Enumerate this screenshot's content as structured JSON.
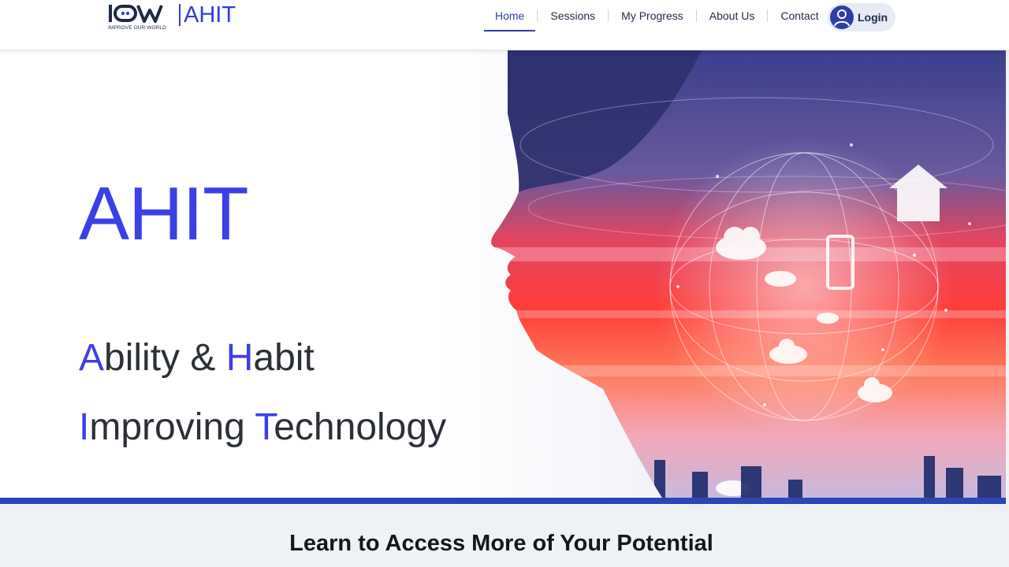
{
  "brand": {
    "mark": "IOW",
    "tagline": "IMPROVE OUR WORLD",
    "product": "AHIT",
    "color_primary": "#2d3ee0",
    "color_dark": "#1f2a44"
  },
  "nav": {
    "items": [
      {
        "label": "Home",
        "active": true
      },
      {
        "label": "Sessions",
        "active": false
      },
      {
        "label": "My Progress",
        "active": false
      },
      {
        "label": "About Us",
        "active": false
      },
      {
        "label": "Contact",
        "active": false
      }
    ],
    "login_label": "Login",
    "login_icon": "user-icon"
  },
  "hero": {
    "title": "AHIT",
    "line1": {
      "c1": "A",
      "t1": "bility & ",
      "c2": "H",
      "t2": "abit"
    },
    "line2": {
      "c1": "I",
      "t1": "mproving ",
      "c2": "T",
      "t2": "echnology"
    },
    "accent_color": "#3b3fe6",
    "image": "profile-of-woman-with-technology-network-overlay"
  },
  "section": {
    "title": "Learn to Access More of Your Potential"
  }
}
